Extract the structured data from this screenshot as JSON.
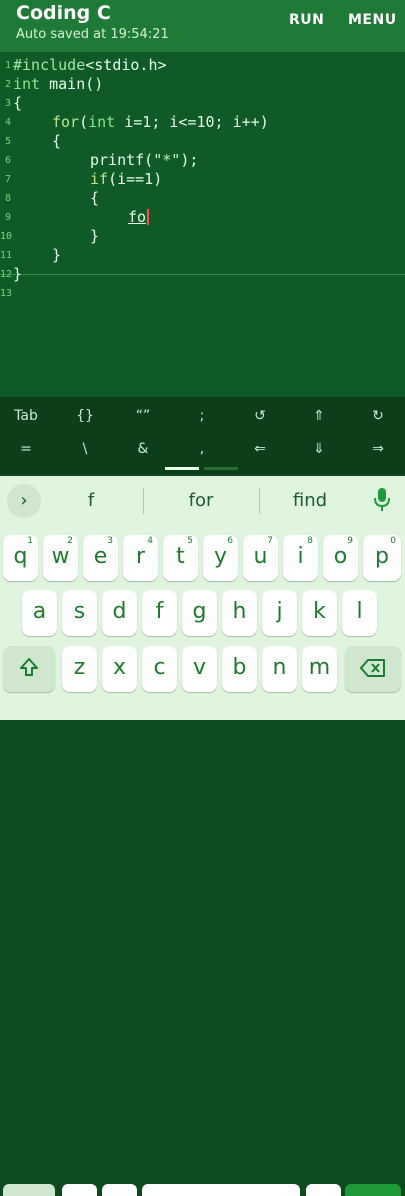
{
  "app": {
    "title": "Coding C",
    "subtitle": "Auto saved at 19:54:21",
    "run_label": "RUN",
    "menu_label": "MENU"
  },
  "editor": {
    "lines": [
      {
        "num": "1"
      },
      {
        "num": "2"
      },
      {
        "num": "3"
      },
      {
        "num": "4"
      },
      {
        "num": "5"
      },
      {
        "num": "6"
      },
      {
        "num": "7"
      },
      {
        "num": "8"
      },
      {
        "num": "9"
      },
      {
        "num": "10"
      },
      {
        "num": "11"
      },
      {
        "num": "12"
      },
      {
        "num": "13"
      }
    ],
    "tokens": {
      "l1a": "#include",
      "l1b": "<stdio.h>",
      "l2a": "int",
      " l2b": " main()",
      "l3a": "{",
      "l4a": "for",
      "l4b": "(",
      "l4c": "int",
      "l4d": " i=1; i<=10; i++)",
      "l5a": "{",
      "l6a": "printf(",
      "l6b": "\"*\"",
      "l6c": ");",
      "l7a": "if",
      "l7b": "(i==1)",
      "l8a": "{",
      "l9a": "fo",
      "l10a": "}",
      "l11a": "}",
      "l12a": "}"
    }
  },
  "symbols": {
    "row1": [
      "Tab",
      "{}",
      "“”",
      ";",
      "↺",
      "⇑",
      "↻"
    ],
    "row2": [
      "=",
      "\\",
      "&",
      ",",
      "⇐",
      "⇓",
      "⇒"
    ]
  },
  "keyboard": {
    "suggestions": [
      "f",
      "for",
      "find"
    ],
    "row1": [
      {
        "k": "q",
        "h": "1"
      },
      {
        "k": "w",
        "h": "2"
      },
      {
        "k": "e",
        "h": "3"
      },
      {
        "k": "r",
        "h": "4"
      },
      {
        "k": "t",
        "h": "5"
      },
      {
        "k": "y",
        "h": "6"
      },
      {
        "k": "u",
        "h": "7"
      },
      {
        "k": "i",
        "h": "8"
      },
      {
        "k": "o",
        "h": "9"
      },
      {
        "k": "p",
        "h": "0"
      }
    ],
    "row2": [
      "a",
      "s",
      "d",
      "f",
      "g",
      "h",
      "j",
      "k",
      "l"
    ],
    "row3": [
      "z",
      "x",
      "c",
      "v",
      "b",
      "n",
      "m"
    ]
  },
  "colors": {
    "appbar": "#1f7a36",
    "editor_bg": "#0f5a26",
    "accent_key_text": "#1e7a2e",
    "cursor": "#ff4d4d"
  },
  "icons": {
    "suggestion_expand": "chevron-right-icon",
    "mic": "microphone-icon",
    "shift": "shift-arrow-icon",
    "backspace": "backspace-icon"
  }
}
